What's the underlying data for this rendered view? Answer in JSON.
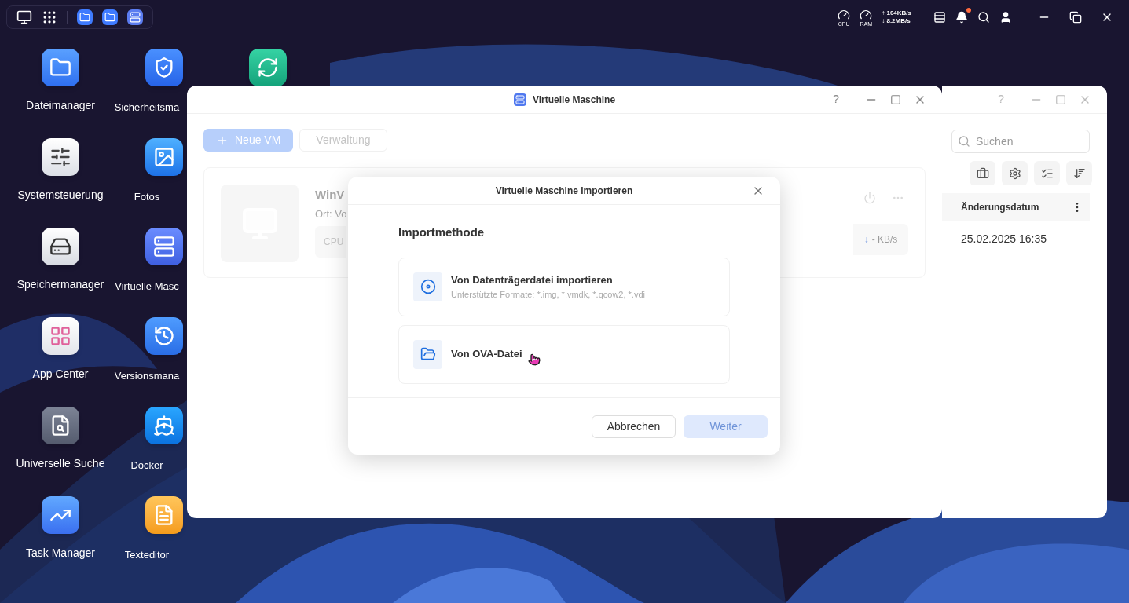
{
  "top_bar": {
    "cpu_label": "CPU",
    "ram_label": "RAM",
    "upload": "↑ 104KB/s",
    "download": "↓ 8.2MB/s",
    "notification_dot": true
  },
  "desktop_columns": [
    [
      {
        "kind": "files",
        "label": "Dateimanager"
      },
      {
        "kind": "settings",
        "label": "Systemsteuerung"
      },
      {
        "kind": "storage",
        "label": "Speichermanager"
      },
      {
        "kind": "appcenter",
        "label": "App Center"
      },
      {
        "kind": "search",
        "label": "Universelle Suche"
      },
      {
        "kind": "taskmanager",
        "label": "Task Manager"
      }
    ],
    [
      {
        "kind": "security",
        "label": "Sicherheitsma"
      },
      {
        "kind": "photos",
        "label": "Fotos"
      },
      {
        "kind": "vm",
        "label": "Virtuelle Masc"
      },
      {
        "kind": "versions",
        "label": "Versionsmana"
      },
      {
        "kind": "docker",
        "label": "Docker"
      },
      {
        "kind": "editor",
        "label": "Texteditor"
      }
    ],
    [
      {
        "kind": "sync"
      }
    ]
  ],
  "main_window": {
    "title": "Virtuelle Maschine",
    "help": "?",
    "new_button": "Neue VM",
    "manage_button": "Verwaltung",
    "vm_card": {
      "name": "WinV",
      "location": "Ort: Vo",
      "cpu_label": "CPU",
      "network_arrow": "↓",
      "network": "- KB/s"
    }
  },
  "back_window": {
    "help": "?",
    "search_placeholder": "Suchen",
    "column_header": "Änderungsdatum",
    "cell": "25.02.2025 16:35"
  },
  "dialog": {
    "title": "Virtuelle Maschine importieren",
    "heading": "Importmethode",
    "options": [
      {
        "kind": "disk",
        "title": "Von Datenträgerdatei importieren",
        "subtitle": "Unterstützte Formate: *.img, *.vmdk, *.qcow2, *.vdi"
      },
      {
        "kind": "ova",
        "title": "Von OVA-Datei"
      }
    ],
    "buttons": [
      {
        "label": "Abbrechen",
        "kind": "secondary",
        "disabled": false
      },
      {
        "label": "Weiter",
        "kind": "primary",
        "disabled": true
      }
    ]
  }
}
